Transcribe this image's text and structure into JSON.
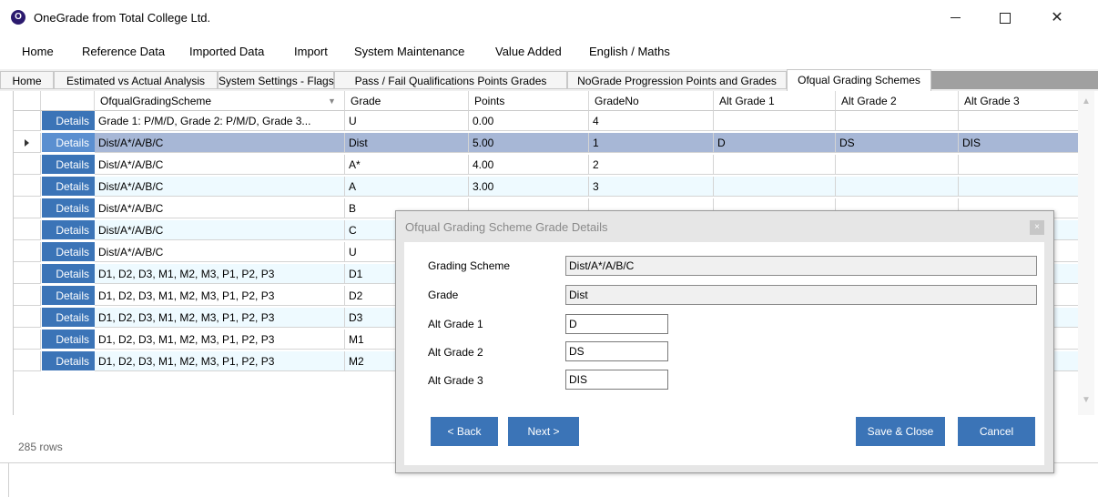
{
  "window": {
    "title": "OneGrade from Total College Ltd.",
    "logo_letter": "O"
  },
  "menu": [
    "Home",
    "Reference Data",
    "Imported Data",
    "Import",
    "System Maintenance",
    "Value Added",
    "English / Maths"
  ],
  "tabs": [
    "Home",
    "Estimated vs Actual Analysis",
    "System Settings - Flags",
    "Pass / Fail Qualifications Points Grades",
    "NoGrade Progression Points and Grades",
    "Ofqual Grading Schemes"
  ],
  "active_tab_index": 5,
  "grid": {
    "columns": [
      "OfqualGradingScheme",
      "Grade",
      "Points",
      "GradeNo",
      "Alt Grade 1",
      "Alt Grade 2",
      "Alt Grade 3"
    ],
    "details_label": "Details",
    "selected_row_index": 1,
    "rows": [
      [
        "Grade 1: P/M/D, Grade 2: P/M/D, Grade 3...",
        "U",
        "0.00",
        "4",
        "",
        "",
        ""
      ],
      [
        "Dist/A*/A/B/C",
        "Dist",
        "5.00",
        "1",
        "D",
        "DS",
        "DIS"
      ],
      [
        "Dist/A*/A/B/C",
        "A*",
        "4.00",
        "2",
        "",
        "",
        ""
      ],
      [
        "Dist/A*/A/B/C",
        "A",
        "3.00",
        "3",
        "",
        "",
        ""
      ],
      [
        "Dist/A*/A/B/C",
        "B",
        "",
        "",
        "",
        "",
        ""
      ],
      [
        "Dist/A*/A/B/C",
        "C",
        "",
        "",
        "",
        "",
        ""
      ],
      [
        "Dist/A*/A/B/C",
        "U",
        "",
        "",
        "",
        "",
        ""
      ],
      [
        "D1, D2, D3, M1, M2, M3, P1, P2, P3",
        "D1",
        "",
        "",
        "",
        "",
        ""
      ],
      [
        "D1, D2, D3, M1, M2, M3, P1, P2, P3",
        "D2",
        "",
        "",
        "",
        "",
        ""
      ],
      [
        "D1, D2, D3, M1, M2, M3, P1, P2, P3",
        "D3",
        "",
        "",
        "",
        "",
        ""
      ],
      [
        "D1, D2, D3, M1, M2, M3, P1, P2, P3",
        "M1",
        "",
        "",
        "",
        "",
        ""
      ],
      [
        "D1, D2, D3, M1, M2, M3, P1, P2, P3",
        "M2",
        "",
        "",
        "",
        "",
        ""
      ]
    ]
  },
  "row_count": "285 rows",
  "dialog": {
    "title": "Ofqual Grading Scheme Grade Details",
    "close_glyph": "×",
    "fields": {
      "grading_scheme": {
        "label": "Grading Scheme",
        "value": "Dist/A*/A/B/C"
      },
      "grade": {
        "label": "Grade",
        "value": "Dist"
      },
      "alt_grade_1": {
        "label": "Alt Grade 1",
        "value": "D"
      },
      "alt_grade_2": {
        "label": "Alt Grade 2",
        "value": "DS"
      },
      "alt_grade_3": {
        "label": "Alt Grade 3",
        "value": "DIS"
      }
    },
    "buttons": {
      "back": "< Back",
      "next": "Next >",
      "save_close": "Save & Close",
      "cancel": "Cancel"
    }
  },
  "colors": {
    "accent": "#3b74b7",
    "selected_row": "#a7b7d6",
    "alt_row": "#eefaff"
  }
}
